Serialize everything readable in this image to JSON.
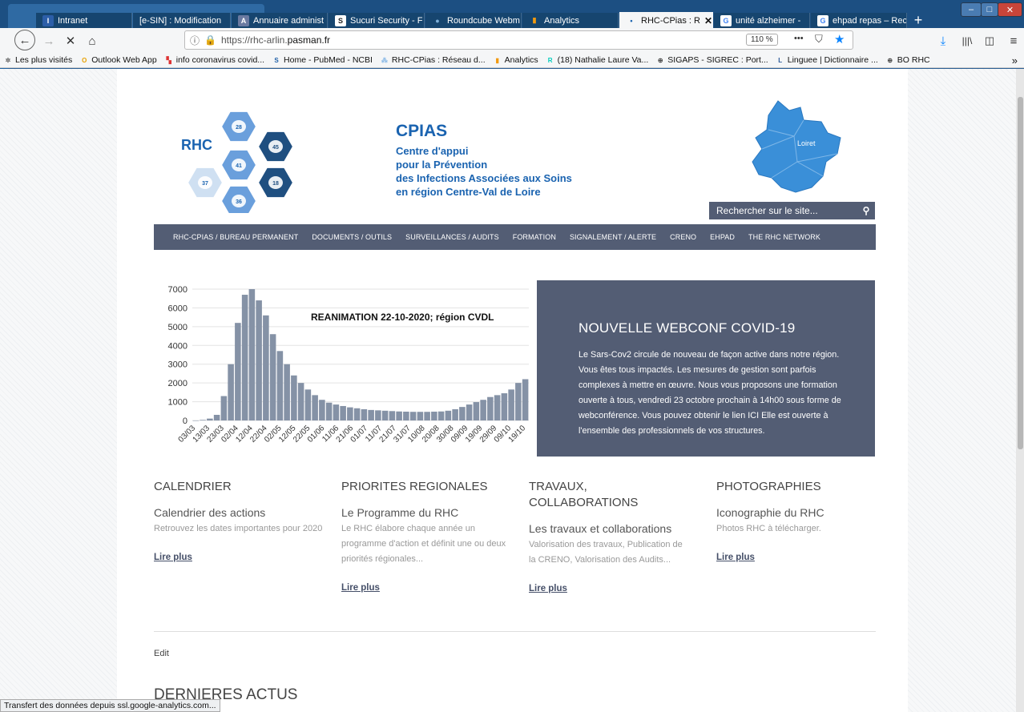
{
  "browser": {
    "tabs": [
      {
        "label": "Intranet",
        "icon": "intranet-icon",
        "color": "#2c5ea8",
        "glyph": "I",
        "active": false
      },
      {
        "label": "[e-SIN] : Modification",
        "icon": "",
        "color": "",
        "glyph": "",
        "active": false
      },
      {
        "label": "Annuaire administ",
        "icon": "annuaire-icon",
        "color": "#6a7aa1",
        "glyph": "A",
        "active": false
      },
      {
        "label": "Sucuri Security - F",
        "icon": "sucuri-icon",
        "color": "#222",
        "glyph": "S",
        "active": false
      },
      {
        "label": "Roundcube Webm",
        "icon": "roundcube-icon",
        "color": "#7fb0d9",
        "glyph": "●",
        "active": false
      },
      {
        "label": "Analytics",
        "icon": "analytics-icon",
        "color": "#f29a0f",
        "glyph": "▮",
        "active": false
      },
      {
        "label": "RHC-CPias : R",
        "icon": "dot-icon",
        "color": "#1a63b0",
        "glyph": "•",
        "active": true
      },
      {
        "label": "unité alzheimer -",
        "icon": "google-icon",
        "color": "#4285f4",
        "glyph": "G",
        "active": false
      },
      {
        "label": "ehpad repas – Rec",
        "icon": "google-icon",
        "color": "#4285f4",
        "glyph": "G",
        "active": false
      }
    ],
    "new_tab": "+",
    "window_controls": {
      "minimize": "–",
      "maximize": "□",
      "close": "✕"
    },
    "url": "https://rhc-arlin.pasman.fr",
    "url_prefix": "https://rhc-arlin.",
    "url_host": "pasman.fr",
    "zoom": "110 %",
    "more": "•••",
    "bookmarks": [
      {
        "label": "Les plus visités",
        "icon": "gear-icon",
        "color": "#666",
        "glyph": "✲"
      },
      {
        "label": "Outlook Web App",
        "icon": "outlook-icon",
        "color": "#e8a100",
        "glyph": "O"
      },
      {
        "label": "info coronavirus covid...",
        "icon": "flag-icon",
        "color": "#d33",
        "glyph": "▚"
      },
      {
        "label": "Home - PubMed - NCBI",
        "icon": "ncbi-icon",
        "color": "#2060a8",
        "glyph": "S"
      },
      {
        "label": "RHC-CPias : Réseau d...",
        "icon": "rhc-icon",
        "color": "#7fb3e5",
        "glyph": "⁂"
      },
      {
        "label": "Analytics",
        "icon": "analytics-icon",
        "color": "#f29a0f",
        "glyph": "▮"
      },
      {
        "label": "(18) Nathalie Laure Va...",
        "icon": "researchgate-icon",
        "color": "#00ccbb",
        "glyph": "R"
      },
      {
        "label": "SIGAPS - SIGREC : Port...",
        "icon": "globe-icon",
        "color": "#444",
        "glyph": "⊕"
      },
      {
        "label": "Linguee | Dictionnaire ...",
        "icon": "linguee-icon",
        "color": "#2d5a9a",
        "glyph": "L"
      },
      {
        "label": "BO RHC",
        "icon": "globe-icon",
        "color": "#444",
        "glyph": "⊕"
      }
    ],
    "overflow": "»",
    "status": "Transfert des données depuis ssl.google-analytics.com..."
  },
  "header": {
    "logo_text": "RHC",
    "hex_labels": [
      "28",
      "45",
      "41",
      "37",
      "18",
      "36"
    ],
    "cpias_title": "CPIAS",
    "cpias_lines": [
      "Centre d'appui",
      "pour la Prévention",
      "des Infections Associées aux Soins",
      "en région Centre-Val de Loire"
    ],
    "map_label": "Loiret",
    "search_placeholder": "Rechercher sur le site...",
    "accent": "#1a63b0"
  },
  "nav": [
    "RHC-CPIAS / BUREAU PERMANENT",
    "DOCUMENTS / OUTILS",
    "SURVEILLANCES / AUDITS",
    "FORMATION",
    "SIGNALEMENT / ALERTE",
    "CRENO",
    "EHPAD",
    "THE RHC NETWORK"
  ],
  "chart_data": {
    "type": "bar",
    "title": "REANIMATION 22-10-2020; région CVDL",
    "yticks": [
      0,
      1000,
      2000,
      3000,
      4000,
      5000,
      6000,
      7000
    ],
    "ylim": [
      0,
      7000
    ],
    "xtick_labels": [
      "03/03",
      "13/03",
      "23/03",
      "02/04",
      "12/04",
      "22/04",
      "02/05",
      "12/05",
      "22/05",
      "01/06",
      "11/06",
      "21/06",
      "01/07",
      "11/07",
      "21/07",
      "31/07",
      "10/08",
      "20/08",
      "30/08",
      "09/09",
      "19/09",
      "29/09",
      "09/10",
      "19/10"
    ],
    "grid": true,
    "categories": [
      "03/03",
      "08/03",
      "13/03",
      "18/03",
      "23/03",
      "28/03",
      "02/04",
      "07/04",
      "12/04",
      "17/04",
      "22/04",
      "27/04",
      "02/05",
      "07/05",
      "12/05",
      "17/05",
      "22/05",
      "27/05",
      "01/06",
      "06/06",
      "11/06",
      "16/06",
      "21/06",
      "26/06",
      "01/07",
      "06/07",
      "11/07",
      "16/07",
      "21/07",
      "26/07",
      "31/07",
      "05/08",
      "10/08",
      "15/08",
      "20/08",
      "25/08",
      "30/08",
      "04/09",
      "09/09",
      "14/09",
      "19/09",
      "24/09",
      "29/09",
      "04/10",
      "09/10",
      "14/10",
      "19/10",
      "22/10"
    ],
    "values": [
      0,
      30,
      100,
      300,
      1300,
      3000,
      5200,
      6700,
      7000,
      6400,
      5600,
      4600,
      3700,
      3000,
      2400,
      2000,
      1650,
      1350,
      1100,
      950,
      850,
      770,
      700,
      650,
      600,
      560,
      540,
      520,
      500,
      480,
      470,
      460,
      460,
      460,
      470,
      480,
      520,
      600,
      720,
      850,
      980,
      1100,
      1250,
      1350,
      1450,
      1650,
      2000,
      2200
    ],
    "bar_color": "#8592a6"
  },
  "promo": {
    "title": "NOUVELLE WEBCONF COVID-19",
    "text": "Le Sars-Cov2 circule de nouveau de façon active dans notre région. Vous êtes tous impactés. Les mesures de gestion sont parfois complexes à mettre en œuvre. Nous vous proposons une formation ouverte à tous, vendredi 23 octobre prochain à 14h00 sous forme de webconférence. Vous pouvez obtenir le lien ICI Elle est ouverte à l'ensemble des professionnels de vos structures."
  },
  "columns": [
    {
      "heading": "CALENDRIER",
      "subheading": "Calendrier des actions",
      "text": "Retrouvez les dates importantes pour 2020",
      "link": "Lire plus"
    },
    {
      "heading": "PRIORITES REGIONALES",
      "subheading": "Le Programme du RHC",
      "text": "Le RHC élabore chaque année un programme d'action et définit une ou deux priorités régionales...",
      "link": "Lire plus"
    },
    {
      "heading": "TRAVAUX, COLLABORATIONS",
      "subheading": "Les travaux et collaborations",
      "text": "Valorisation des travaux, Publication de la CRENO, Valorisation des Audits...",
      "link": "Lire plus"
    },
    {
      "heading": "PHOTOGRAPHIES",
      "subheading": "Iconographie du RHC",
      "text": "Photos RHC à télécharger.",
      "link": "Lire plus"
    }
  ],
  "edit": "Edit",
  "actus_title": "DERNIERES ACTUS"
}
